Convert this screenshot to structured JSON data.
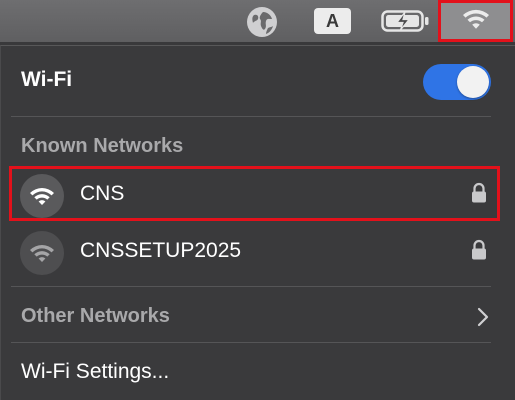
{
  "menubar": {
    "input_source_label": "A",
    "icons": [
      "globe-icon",
      "input-source-icon",
      "battery-charging-icon",
      "wifi-icon"
    ]
  },
  "panel": {
    "title": "Wi-Fi",
    "wifi_enabled": true,
    "known_networks_label": "Known Networks",
    "known_networks": [
      {
        "name": "CNS",
        "locked": true,
        "highlighted": true
      },
      {
        "name": "CNSSETUP2025",
        "locked": true,
        "highlighted": false
      }
    ],
    "other_networks_label": "Other Networks",
    "settings_label": "Wi-Fi Settings..."
  },
  "colors": {
    "toggle_on": "#2f74e6",
    "highlight": "#e3111b",
    "panel_bg": "#3a3a3c",
    "menubar_bg": "#6e6e70"
  }
}
